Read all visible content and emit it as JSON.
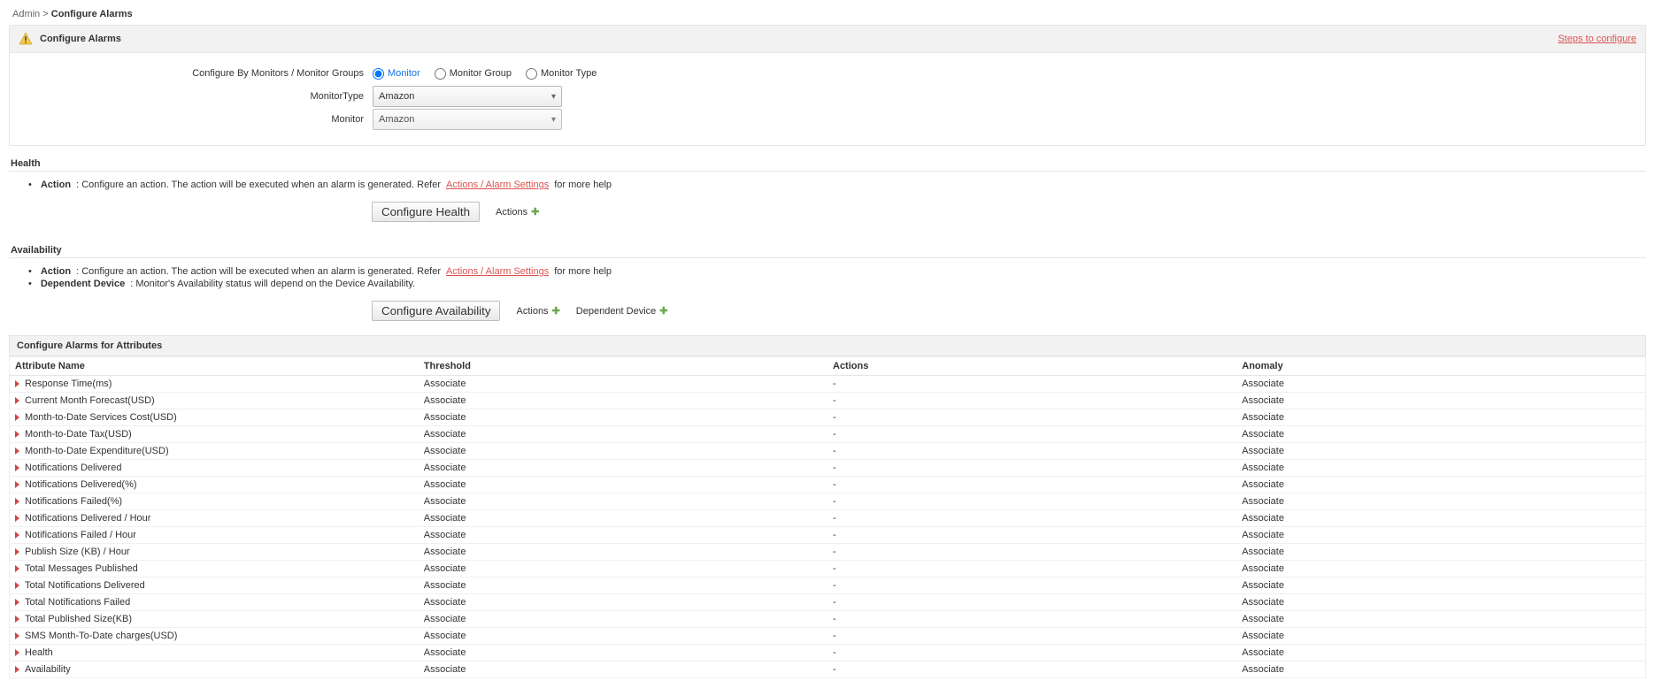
{
  "breadcrumb": {
    "admin": "Admin",
    "sep": ">",
    "current": "Configure Alarms"
  },
  "panel": {
    "title": "Configure Alarms",
    "steps_link": "Steps to configure",
    "config_by_label": "Configure By Monitors / Monitor Groups",
    "radios": {
      "monitor": "Monitor",
      "monitor_group": "Monitor Group",
      "monitor_type": "Monitor Type"
    },
    "monitor_type_label": "MonitorType",
    "monitor_type_value": "Amazon",
    "monitor_label": "Monitor",
    "monitor_value": "Amazon"
  },
  "health": {
    "title": "Health",
    "action_label": "Action",
    "action_text_pre": ": Configure an action. The action will be executed when an alarm is generated. Refer",
    "link_text": "Actions / Alarm Settings",
    "action_text_post": "for more help",
    "button": "Configure Health",
    "actions_add": "Actions"
  },
  "availability": {
    "title": "Availability",
    "action_label": "Action",
    "action_text_pre": ": Configure an action. The action will be executed when an alarm is generated. Refer",
    "link_text": "Actions / Alarm Settings",
    "action_text_post": "for more help",
    "dependent_label": "Dependent Device",
    "dependent_text": ": Monitor's Availability status will depend on the Device Availability.",
    "button": "Configure Availability",
    "actions_add": "Actions",
    "dependent_add": "Dependent Device"
  },
  "attributes": {
    "section_title": "Configure Alarms for Attributes",
    "headers": {
      "name": "Attribute Name",
      "threshold": "Threshold",
      "actions": "Actions",
      "anomaly": "Anomaly"
    },
    "associate": "Associate",
    "dash": "-",
    "rows": [
      {
        "name": "Response Time(ms)"
      },
      {
        "name": "Current Month Forecast(USD)"
      },
      {
        "name": "Month-to-Date Services Cost(USD)"
      },
      {
        "name": "Month-to-Date Tax(USD)"
      },
      {
        "name": "Month-to-Date Expenditure(USD)"
      },
      {
        "name": "Notifications Delivered"
      },
      {
        "name": "Notifications Delivered(%)"
      },
      {
        "name": "Notifications Failed(%)"
      },
      {
        "name": "Notifications Delivered / Hour"
      },
      {
        "name": "Notifications Failed / Hour"
      },
      {
        "name": "Publish Size (KB) / Hour"
      },
      {
        "name": "Total Messages Published"
      },
      {
        "name": "Total Notifications Delivered"
      },
      {
        "name": "Total Notifications Failed"
      },
      {
        "name": "Total Published Size(KB)"
      },
      {
        "name": "SMS Month-To-Date charges(USD)"
      },
      {
        "name": "Health"
      },
      {
        "name": "Availability"
      }
    ]
  }
}
